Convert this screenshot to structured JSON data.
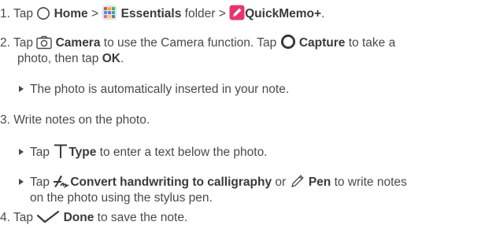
{
  "steps": {
    "s1": {
      "num": "1.",
      "tap": "Tap",
      "home": "Home",
      "sep1": ">",
      "essentials": "Essentials",
      "folder_sep": "folder >",
      "quickmemo": "QuickMemo+",
      "end": "."
    },
    "s2": {
      "num": "2.",
      "tap1": "Tap",
      "camera": "Camera",
      "mid1": "to use the Camera function. Tap",
      "capture": "Capture",
      "mid2": "to take a",
      "cont1": "photo, then tap",
      "ok": "OK",
      "end": "."
    },
    "s2_note": {
      "text": "The photo is automatically inserted in your note."
    },
    "s3": {
      "num": "3.",
      "text": "Write notes on the photo."
    },
    "b1": {
      "tap": "Tap",
      "type": "Type",
      "rest": "to enter a text below the photo."
    },
    "b2": {
      "tap": "Tap",
      "convert": "Convert handwriting to calligraphy",
      "or": "or",
      "pen": "Pen",
      "rest": "to write notes",
      "cont": "on the photo using the stylus pen."
    },
    "s4": {
      "num": "4.",
      "tap": "Tap",
      "done": "Done",
      "rest": "to save the note."
    }
  },
  "icons": {
    "home": "home-circle-icon",
    "essentials": "essentials-folder-icon",
    "quickmemo": "quickmemo-pen-icon",
    "camera": "camera-icon",
    "capture": "capture-button-icon",
    "type": "text-type-icon",
    "calligraphy": "calligraphy-pen-icon",
    "pen": "pen-icon",
    "done": "checkmark-done-icon"
  },
  "colors": {
    "text": "#4a4a4a",
    "quickmemo_accent": "#e7356f"
  }
}
